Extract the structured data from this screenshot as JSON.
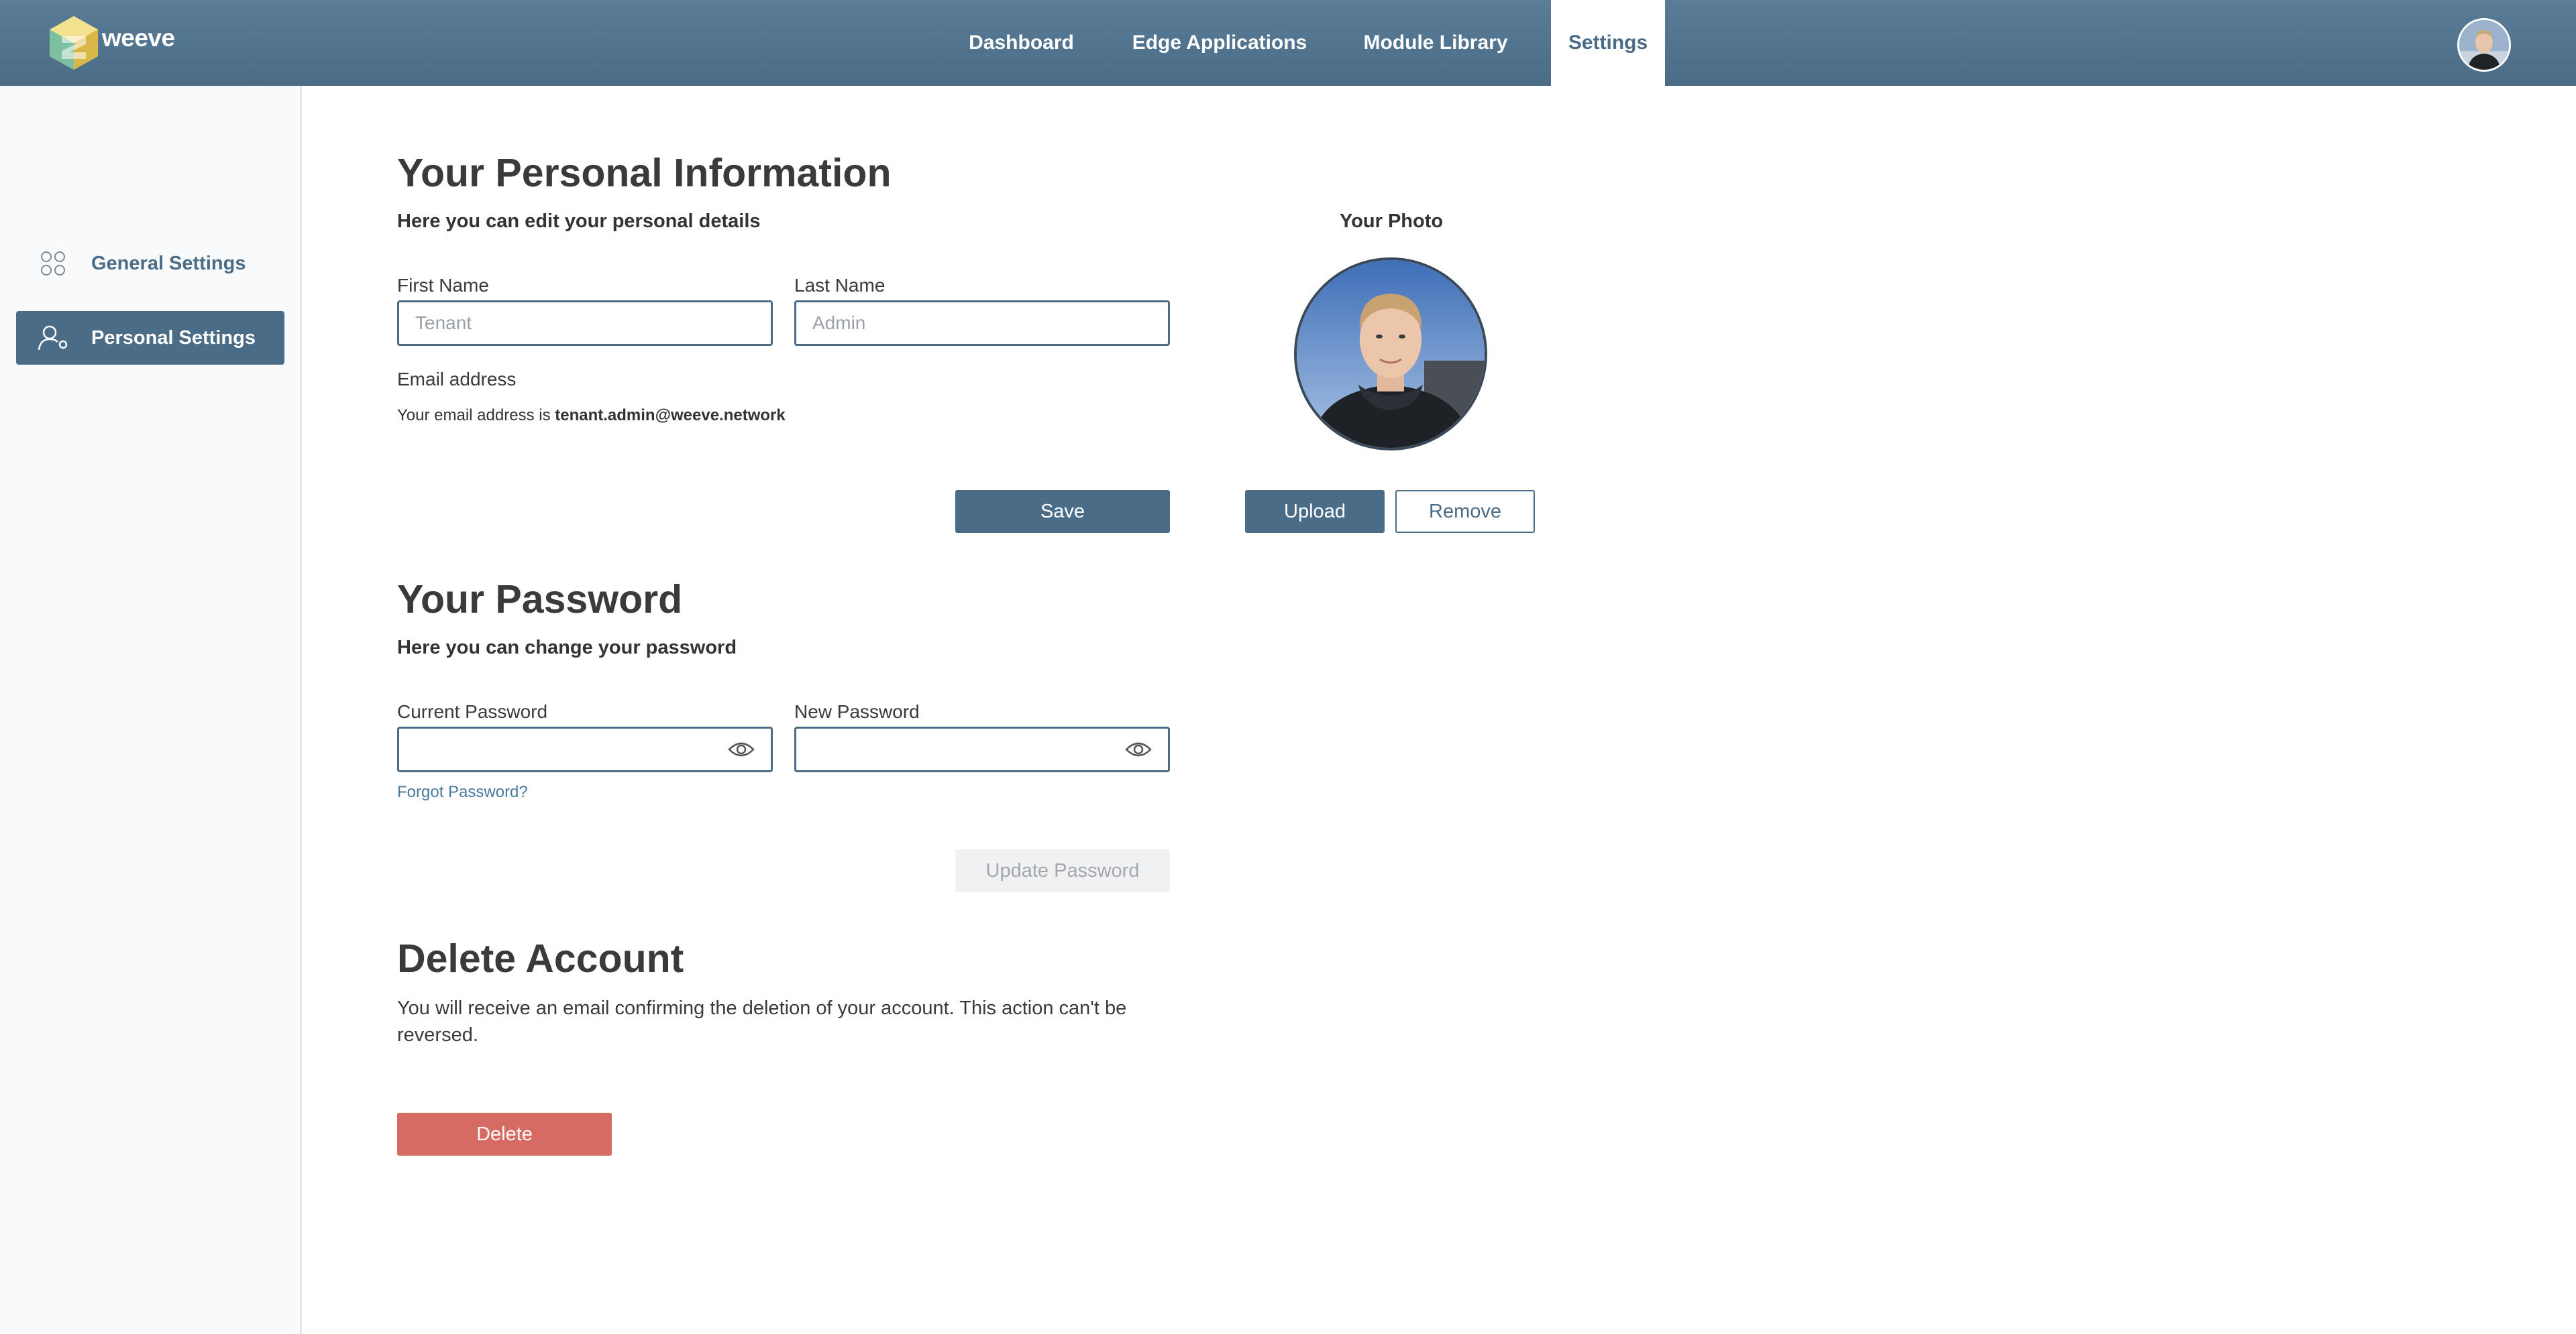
{
  "app": {
    "brand": "weeve"
  },
  "nav": {
    "dashboard": "Dashboard",
    "edge_applications": "Edge Applications",
    "module_library": "Module Library",
    "settings": "Settings"
  },
  "sidebar": {
    "items": [
      {
        "label": "General Settings",
        "icon": "grid-circles-icon"
      },
      {
        "label": "Personal Settings",
        "icon": "user-gear-icon"
      }
    ]
  },
  "personal": {
    "title": "Your Personal Information",
    "subtitle": "Here you can edit your personal details",
    "first_name_label": "First Name",
    "first_name_placeholder": "Tenant",
    "last_name_label": "Last Name",
    "last_name_placeholder": "Admin",
    "email_label": "Email address",
    "email_prefix": "Your email address is",
    "email_value": "tenant.admin@weeve.network",
    "save_label": "Save"
  },
  "photo": {
    "title": "Your Photo",
    "upload_label": "Upload",
    "remove_label": "Remove"
  },
  "password": {
    "title": "Your Password",
    "subtitle": "Here you can change your password",
    "current_label": "Current Password",
    "new_label": "New Password",
    "forgot_label": "Forgot Password?",
    "update_label": "Update Password"
  },
  "delete": {
    "title": "Delete Account",
    "description": "You will receive an email confirming the deletion of your account. This action can't be reversed.",
    "button_label": "Delete"
  },
  "colors": {
    "primary": "#4a6c87",
    "danger": "#d56b61",
    "sidebar_bg": "#f9fafb"
  }
}
